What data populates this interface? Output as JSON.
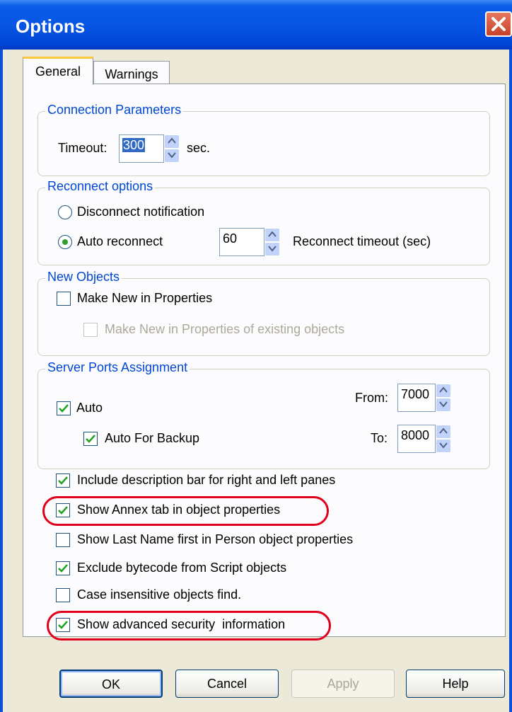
{
  "window": {
    "title": "Options"
  },
  "tabs": [
    {
      "label": "General"
    },
    {
      "label": "Warnings"
    }
  ],
  "connection": {
    "legend": "Connection Parameters",
    "timeout_label": "Timeout:",
    "timeout_value": "300",
    "unit": "sec."
  },
  "reconnect": {
    "legend": "Reconnect options",
    "disconnect_label": "Disconnect notification",
    "auto_label": "Auto reconnect",
    "timeout_value": "60",
    "timeout_label": "Reconnect timeout (sec)",
    "selected": "Auto reconnect"
  },
  "new_objects": {
    "legend": "New Objects",
    "make_new_label": "Make New in Properties",
    "make_new_checked": false,
    "make_new_existing_label": "Make New in Properties of existing objects",
    "make_new_existing_checked": false,
    "make_new_existing_enabled": false
  },
  "ports": {
    "legend": "Server Ports Assignment",
    "auto_label": "Auto",
    "auto_checked": true,
    "auto_backup_label": "Auto For Backup",
    "auto_backup_checked": true,
    "from_label": "From:",
    "from_value": "7000",
    "to_label": "To:",
    "to_value": "8000"
  },
  "options": [
    {
      "label": "Include description bar for right and left panes",
      "checked": true
    },
    {
      "label": "Show Annex tab in object properties",
      "checked": true,
      "highlighted": true
    },
    {
      "label": "Show Last Name first in Person object properties",
      "checked": false
    },
    {
      "label": "Exclude bytecode from Script objects",
      "checked": true
    },
    {
      "label": "Case insensitive objects find.",
      "checked": false
    },
    {
      "label": "Show advanced security  information",
      "checked": true,
      "highlighted": true
    }
  ],
  "buttons": {
    "ok": "OK",
    "cancel": "Cancel",
    "apply": "Apply",
    "help": "Help"
  },
  "colors": {
    "title_bar": "#0756e4",
    "highlight_ring": "#e0001b",
    "group_legend": "#0046d5"
  }
}
